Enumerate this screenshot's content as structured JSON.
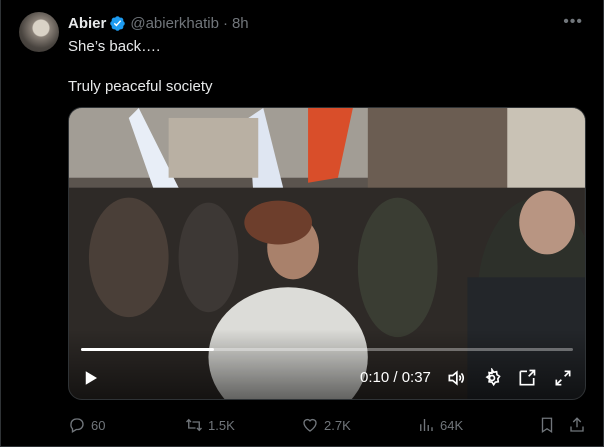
{
  "tweet": {
    "author_name": "Abier",
    "handle": "@abierkhatib",
    "separator": "·",
    "time": "8h",
    "text_line1": "She’s back….",
    "text_line2": "Truly peaceful society"
  },
  "video": {
    "time_display": "0:10 / 0:37",
    "progress": 0.27,
    "controls": [
      "play-icon",
      "volume-icon",
      "settings-icon",
      "pip-icon",
      "fullscreen-icon"
    ]
  },
  "actions": {
    "replies": "60",
    "reposts": "1.5K",
    "likes": "2.7K",
    "views": "64K"
  },
  "colors": {
    "background": "#000000",
    "text": "#e7e9ea",
    "secondary": "#71767b",
    "verified": "#1d9bf0"
  }
}
